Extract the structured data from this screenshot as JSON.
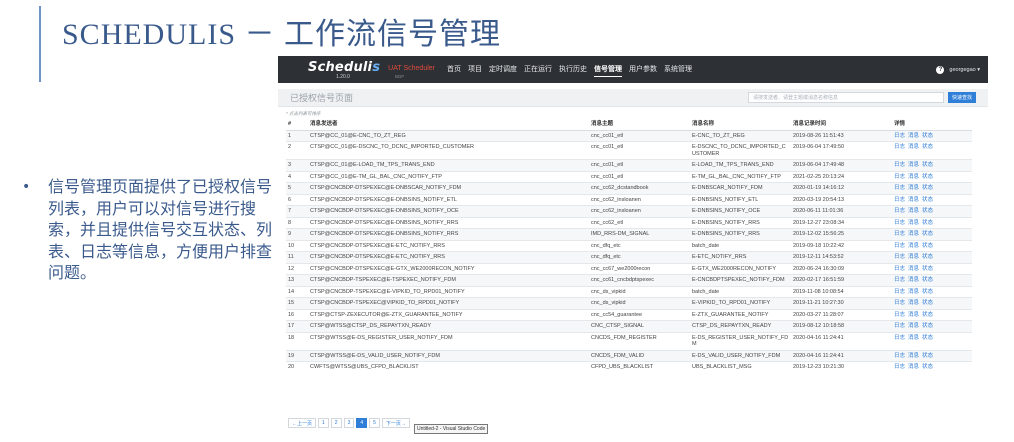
{
  "slide": {
    "title": "SCHEDULIS － 工作流信号管理",
    "bullet": "信号管理页面提供了已授权信号列表，用户可以对信号进行搜索，并且提供信号交互状态、列表、日志等信息，方便用户排查问题。",
    "bullet_symbol": "•"
  },
  "app": {
    "logo_main": "Scheduli",
    "logo_accent": "s",
    "version": "1.20.0",
    "env_label": "UAT Scheduler",
    "env_sub": "BDP",
    "nav": [
      "首页",
      "项目",
      "定时调度",
      "正在运行",
      "执行历史",
      "信号管理",
      "用户参数",
      "系统管理"
    ],
    "active_nav": "信号管理",
    "help_glyph": "?",
    "user": "georgegao ▾",
    "page_heading": "已授权信号页面",
    "search_placeholder": "请搜发送者、请登主题或消息名称信息",
    "search_button": "快速查找",
    "hint": "* 点击列表可排序",
    "columns": [
      "#",
      "消息发送者",
      "消息主题",
      "消息名称",
      "消息记录时间",
      "详情"
    ],
    "actions": [
      "日志",
      "消息",
      "状态"
    ],
    "rows": [
      [
        "1",
        "CTSP@CC_01@E-CNC_TO_ZT_REG",
        "cnc_cc01_etl",
        "E-CNC_TO_ZT_REG",
        "2019-08-26 11:51:43"
      ],
      [
        "2",
        "CTSP@CC_01@E-DSCNC_TO_DCNC_IMPORTED_CUSTOMER",
        "cnc_cc01_etl",
        "E-DSCNC_TO_DCNC_IMPORTED_CUSTOMER",
        "2019-06-04 17:49:50"
      ],
      [
        "3",
        "CTSP@CC_01@E-LOAD_TM_TPS_TRANS_END",
        "cnc_cc01_etl",
        "E-LOAD_TM_TPS_TRANS_END",
        "2019-06-04 17:49:48"
      ],
      [
        "4",
        "CTSP@CC_01@E-TM_GL_BAL_CNC_NOTIFY_FTP",
        "cnc_cc01_etl",
        "E-TM_GL_BAL_CNC_NOTIFY_FTP",
        "2021-02-25 20:13:24"
      ],
      [
        "5",
        "CTSP@CNCBDP-DTSPEXEC@E-DNBSCAR_NOTIFY_FDM",
        "cnc_cc62_dcstandbook",
        "E-DNBSCAR_NOTIFY_FDM",
        "2020-01-19 14:16:12"
      ],
      [
        "6",
        "CTSP@CNCBDP-DTSPEXEC@E-DNBSINS_NOTIFY_ETL",
        "cnc_cc62_insloanen",
        "E-DNBSINS_NOTIFY_ETL",
        "2020-03-19 20:54:13"
      ],
      [
        "7",
        "CTSP@CNCBDP-DTSPEXEC@E-DNBSINS_NOTIFY_OCE",
        "cnc_cc62_insloanen",
        "E-DNBSINS_NOTIFY_OCE",
        "2020-06-11 11:01:36"
      ],
      [
        "8",
        "CTSP@CNCBDP-DTSPEXEC@E-DNBSINS_NOTIFY_RRS",
        "cnc_cc62_etl",
        "E-DNBSINS_NOTIFY_RRS",
        "2019-12-27 23:08:34"
      ],
      [
        "9",
        "CTSP@CNCBDP-DTSPEXEC@E-DNBSINS_NOTIFY_RRS",
        "IMD_RRS-DM_SIGNAL",
        "E-DNBSINS_NOTIFY_RRS",
        "2019-12-02 15:56:25"
      ],
      [
        "10",
        "CTSP@CNCBDP-DTSPEXEC@E-ETC_NOTIFY_RRS",
        "cnc_dfq_etc",
        "batch_date",
        "2019-09-18 10:22:42"
      ],
      [
        "11",
        "CTSP@CNCBDP-DTSPEXEC@E-ETC_NOTIFY_RRS",
        "cnc_dfq_etc",
        "E-ETC_NOTIFY_RRS",
        "2019-12-11 14:53:52"
      ],
      [
        "12",
        "CTSP@CNCBDP-DTSPEXEC@E-GTX_WE2000RECON_NOTIFY",
        "cnc_cc67_we2000recon",
        "E-GTX_WE2000RECON_NOTIFY",
        "2020-06-24 16:30:09"
      ],
      [
        "13",
        "CTSP@CNCBDP-TSPEXEC@E-TSPEXEC_NOTIFY_FDM",
        "cnc_cc61_cncbdptspexec",
        "E-CNCBDPTSPEXEC_NOTIFY_FDM",
        "2020-02-17 16:51:59"
      ],
      [
        "14",
        "CTSP@CNCBDP-TSPEXEC@E-VIPKID_TO_RPD01_NOTIFY",
        "cnc_ds_vipkid",
        "batch_date",
        "2019-11-08 10:08:54"
      ],
      [
        "15",
        "CTSP@CNCBDP-TSPEXEC@VIPKID_TO_RPD01_NOTIFY",
        "cnc_ds_vipkid",
        "E-VIPKID_TO_RPD01_NOTIFY",
        "2019-11-21 10:27:30"
      ],
      [
        "16",
        "CTSP@CTSP-ZEXECUTOR@E-ZTX_GUARANTEE_NOTIFY",
        "cnc_cc54_guarantee",
        "E-ZTX_GUARANTEE_NOTIFY",
        "2020-03-27 11:28:07"
      ],
      [
        "17",
        "CTSP@WTSS@CTSP_DS_REPAYTXN_READY",
        "CNC_CTSP_SIGNAL",
        "CTSP_DS_REPAYTXN_READY",
        "2019-08-12 10:18:58"
      ],
      [
        "18",
        "CTSP@WTSS@E-DS_REGISTER_USER_NOTIFY_FDM",
        "CNCDS_FDM_REGISTER",
        "E-DS_REGISTER_USER_NOTIFY_FDM",
        "2020-04-16 11:24:41"
      ],
      [
        "19",
        "CTSP@WTSS@E-DS_VALID_USER_NOTIFY_FDM",
        "CNCDS_FDM_VALID",
        "E-DS_VALID_USER_NOTIFY_FDM",
        "2020-04-16 11:24:41"
      ],
      [
        "20",
        "CWFTS@WTSS@UBS_CFPD_BLACKLIST",
        "CFPD_UBS_BLACKLIST",
        "UBS_BLACKLIST_MSG",
        "2019-12-23 10:21:30"
      ]
    ],
    "pagination": {
      "prev": "←上一页",
      "pages": [
        "1",
        "2",
        "3",
        "4",
        "5"
      ],
      "active": "4",
      "next": "下一页→"
    },
    "tooltip": "Untitled-2 - Visual Studio Code"
  },
  "colors": {
    "title": "#3a5a8c",
    "topbar": "#2d3136",
    "accent": "#2f7ed8",
    "env_label": "#e04a3c"
  }
}
